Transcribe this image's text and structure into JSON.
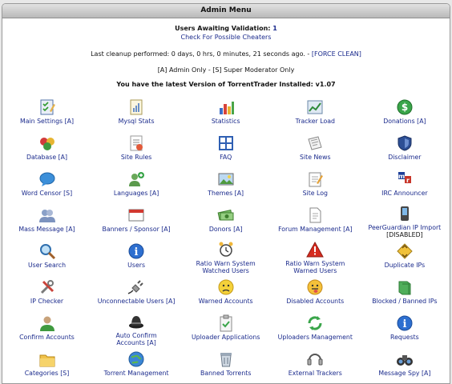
{
  "window": {
    "title": "Admin Menu"
  },
  "info": {
    "awaiting_label": "Users Awaiting Validation:",
    "awaiting_count": "1",
    "cheaters_link": "Check For Possible Cheaters",
    "cleanup_text": "Last cleanup performed: 0 days, 0 hrs, 0 minutes, 21 seconds ago. -",
    "force_clean_link": "[FORCE CLEAN]",
    "legend": "[A] Admin Only - [S] Super Moderator Only",
    "version_text": "You have the latest Version of TorrentTrader Installed: v1.07"
  },
  "menu": [
    {
      "label": "Main Settings [A]",
      "icon": "checklist-icon"
    },
    {
      "label": "Mysql Stats",
      "icon": "stats-page-icon"
    },
    {
      "label": "Statistics",
      "icon": "bar-chart-icon"
    },
    {
      "label": "Tracker Load",
      "icon": "line-chart-icon"
    },
    {
      "label": "Donations [A]",
      "icon": "dollar-icon"
    },
    {
      "label": "Database [A]",
      "icon": "database-icon"
    },
    {
      "label": "Site Rules",
      "icon": "rules-page-icon"
    },
    {
      "label": "FAQ",
      "icon": "faq-grid-icon"
    },
    {
      "label": "Site News",
      "icon": "newspaper-icon"
    },
    {
      "label": "Disclaimer",
      "icon": "shield-icon"
    },
    {
      "label": "Word Censor [S]",
      "icon": "chat-bubble-icon"
    },
    {
      "label": "Languages [A]",
      "icon": "user-add-icon"
    },
    {
      "label": "Themes [A]",
      "icon": "picture-icon"
    },
    {
      "label": "Site Log",
      "icon": "notepad-icon"
    },
    {
      "label": "IRC Announcer",
      "icon": "irc-icon"
    },
    {
      "label": "Mass Message [A]",
      "icon": "users-group-icon"
    },
    {
      "label": "Banners / Sponsor [A]",
      "icon": "banner-window-icon"
    },
    {
      "label": "Donors [A]",
      "icon": "money-icon"
    },
    {
      "label": "Forum Management [A]",
      "icon": "document-icon"
    },
    {
      "label": "PeerGuardian IP Import",
      "label2": "[DISABLED]",
      "icon": "mobile-icon"
    },
    {
      "label": "User Search",
      "icon": "magnifier-icon"
    },
    {
      "label": "Users",
      "icon": "info-circle-icon"
    },
    {
      "label": "Ratio Warn System",
      "label2": "Watched Users",
      "icon": "alarm-clock-icon"
    },
    {
      "label": "Ratio Warn System",
      "label2": "Warned Users",
      "icon": "warning-icon"
    },
    {
      "label": "Duplicate IPs",
      "icon": "arrows-icon"
    },
    {
      "label": "IP Checker",
      "icon": "tools-icon"
    },
    {
      "label": "Unconnectable Users [A]",
      "icon": "plug-icon"
    },
    {
      "label": "Warned Accounts",
      "icon": "sad-face-icon"
    },
    {
      "label": "Disabled Accounts",
      "icon": "tongue-face-icon"
    },
    {
      "label": "Blocked / Banned IPs",
      "icon": "book-icon"
    },
    {
      "label": "Confirm Accounts",
      "icon": "user-green-icon"
    },
    {
      "label": "Auto Confirm",
      "label2": "Accounts [A]",
      "icon": "hat-icon"
    },
    {
      "label": "Uploader Applications",
      "icon": "clipboard-icon"
    },
    {
      "label": "Uploaders Management",
      "icon": "refresh-icon"
    },
    {
      "label": "Requests",
      "icon": "info-circle-icon"
    },
    {
      "label": "Categories [S]",
      "icon": "folder-icon"
    },
    {
      "label": "Torrent Management",
      "icon": "globe-icon"
    },
    {
      "label": "Banned Torrents",
      "icon": "trash-icon"
    },
    {
      "label": "External Trackers",
      "icon": "headset-icon"
    },
    {
      "label": "Message Spy [A]",
      "icon": "binoculars-icon"
    }
  ]
}
